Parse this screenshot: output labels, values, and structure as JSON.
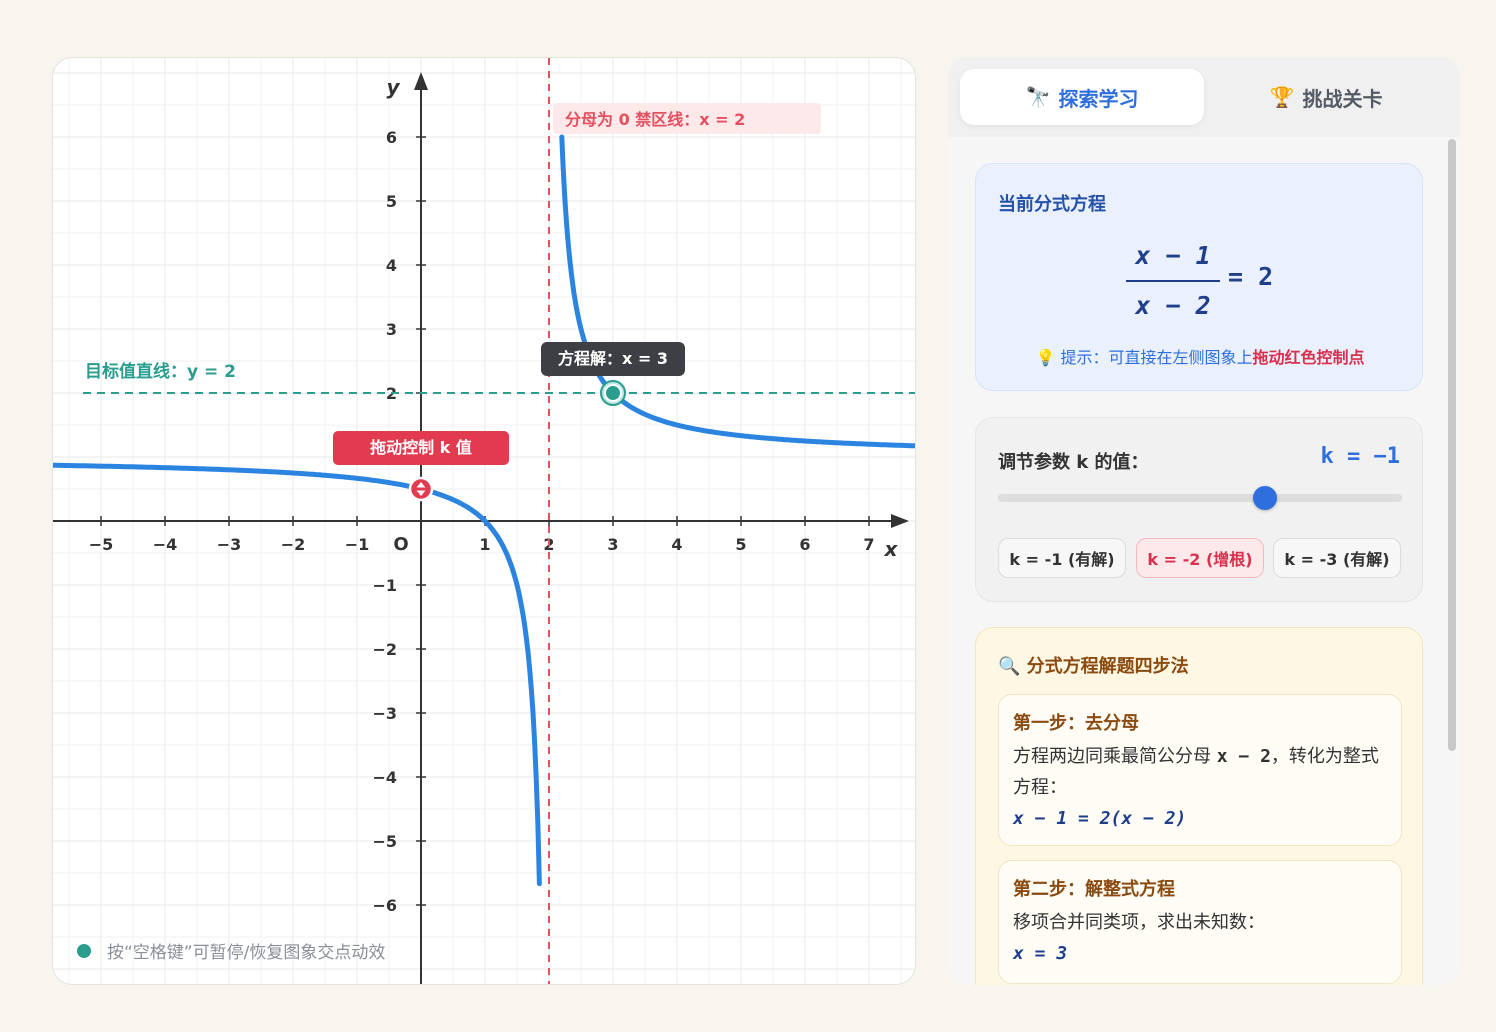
{
  "graph": {
    "y_axis_label": "y",
    "x_axis_label": "x",
    "origin_label": "O",
    "x_ticks": [
      "−5",
      "−4",
      "−3",
      "−2",
      "−1",
      "1",
      "2",
      "3",
      "4",
      "5",
      "6",
      "7"
    ],
    "y_ticks_pos": [
      "1",
      "2",
      "3",
      "4",
      "5",
      "6"
    ],
    "y_ticks_neg": [
      "−1",
      "−2",
      "−3",
      "−4",
      "−5",
      "−6"
    ],
    "asymptote_label": "分母为 0 禁区线：x = 2",
    "target_line_label": "目标值直线：y = 2",
    "solution_label": "方程解：x = 3",
    "drag_label": "拖动控制 k 值",
    "bottom_hint": "按“空格键”可暂停/恢复图象交点动效",
    "colors": {
      "curve": "#2b85e0",
      "asymptote": "#e4505f",
      "target": "#2a9d8f",
      "drag": "#e23a4e"
    }
  },
  "chart_data": {
    "type": "line",
    "function": "y = (x - 1)/(x - 2)",
    "x_range": [
      -5.8,
      7.8
    ],
    "y_range": [
      -6.6,
      7.0
    ],
    "vertical_asymptote": 2,
    "target_line": 2,
    "solution": {
      "x": 3,
      "y": 2
    },
    "control_point": {
      "x": 0,
      "y": 0.5
    }
  },
  "tabs": [
    {
      "icon": "🔭",
      "label": "探索学习"
    },
    {
      "icon": "🏆",
      "label": "挑战关卡"
    }
  ],
  "equation": {
    "title": "当前分式方程",
    "numerator": "x − 1",
    "denominator": "x − 2",
    "rhs": "= 2",
    "hint_prefix": "💡 提示：可直接在左侧图象上",
    "hint_emphasis": "拖动红色控制点"
  },
  "k_control": {
    "label": "调节参数 k 的值：",
    "value": "k = −1",
    "slider_fraction": 0.66,
    "buttons": [
      "k = -1 (有解)",
      "k = -2 (增根)",
      "k = -3 (有解)"
    ]
  },
  "steps": {
    "title": "🔍 分式方程解题四步法",
    "items": [
      {
        "title": "第一步：去分母",
        "text_before": "方程两边同乘最简公分母",
        "text_mono": "x − 2",
        "text_after": "，转化为整式方程：",
        "formula": "x − 1 = 2(x − 2)"
      },
      {
        "title": "第二步：解整式方程",
        "text_before": "移项合并同类项，求出未知数：",
        "text_mono": "",
        "text_after": "",
        "formula": "x = 3"
      }
    ]
  }
}
